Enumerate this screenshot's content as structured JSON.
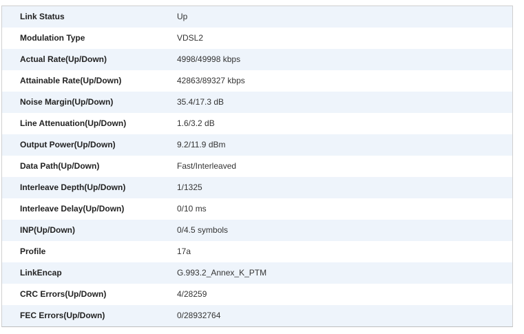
{
  "rows": [
    {
      "label": "Link Status",
      "value": "Up"
    },
    {
      "label": "Modulation Type",
      "value": "VDSL2"
    },
    {
      "label": "Actual Rate(Up/Down)",
      "value": "4998/49998 kbps"
    },
    {
      "label": "Attainable Rate(Up/Down)",
      "value": "42863/89327 kbps"
    },
    {
      "label": "Noise Margin(Up/Down)",
      "value": "35.4/17.3 dB"
    },
    {
      "label": "Line Attenuation(Up/Down)",
      "value": "1.6/3.2 dB"
    },
    {
      "label": "Output Power(Up/Down)",
      "value": "9.2/11.9 dBm"
    },
    {
      "label": "Data Path(Up/Down)",
      "value": "Fast/Interleaved"
    },
    {
      "label": "Interleave Depth(Up/Down)",
      "value": "1/1325"
    },
    {
      "label": "Interleave Delay(Up/Down)",
      "value": "0/10 ms"
    },
    {
      "label": "INP(Up/Down)",
      "value": "0/4.5 symbols"
    },
    {
      "label": "Profile",
      "value": "17a"
    },
    {
      "label": "LinkEncap",
      "value": "G.993.2_Annex_K_PTM"
    },
    {
      "label": "CRC Errors(Up/Down)",
      "value": "4/28259"
    },
    {
      "label": "FEC Errors(Up/Down)",
      "value": "0/28932764"
    }
  ],
  "colors": {
    "row_alt": "#eef4fb",
    "border": "#cfcfcf"
  }
}
